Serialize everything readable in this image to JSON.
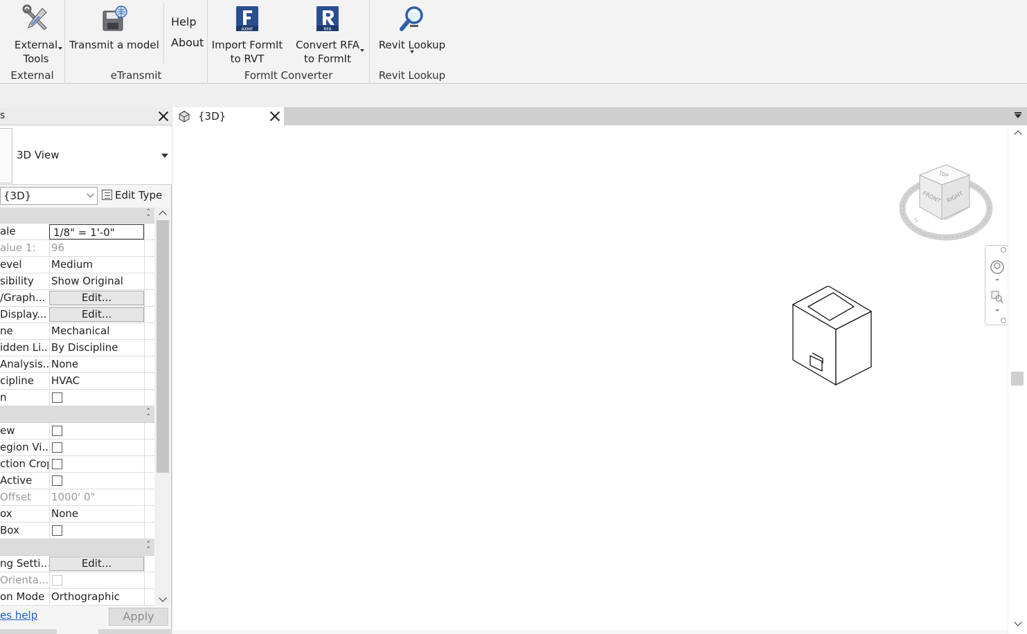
{
  "ribbon": {
    "panels": [
      {
        "title": "External",
        "buttons": [
          {
            "label_line1": "External",
            "label_line2": "Tools",
            "icon": "tools-icon"
          }
        ]
      },
      {
        "title": "eTransmit",
        "buttons": [
          {
            "label": "Transmit a model",
            "icon": "save-globe-icon"
          }
        ],
        "small_buttons": [
          "Help",
          "About"
        ]
      },
      {
        "title": "FormIt Converter",
        "buttons": [
          {
            "label_line1": "Import FormIt",
            "label_line2": "to RVT",
            "icon": "formit-f-icon",
            "badge": "AXMF"
          },
          {
            "label_line1": "Convert RFA",
            "label_line2": "to FormIt",
            "icon": "formit-r-icon",
            "badge": "RFA"
          }
        ]
      },
      {
        "title": "Revit Lookup",
        "buttons": [
          {
            "label": "Revit Lookup",
            "icon": "lookup-icon"
          }
        ]
      }
    ]
  },
  "properties": {
    "title_fragment": "s",
    "type_name": "3D View",
    "instance_selector": "{3D}",
    "edit_type_label": "Edit Type",
    "groups": [
      {
        "rows": [
          {
            "key": "ale",
            "kind": "text-active",
            "value": "1/8\" = 1'-0\""
          },
          {
            "key": "alue    1:",
            "kind": "text-gray",
            "value": "96"
          },
          {
            "key": "evel",
            "kind": "text",
            "value": "Medium"
          },
          {
            "key": "sibility",
            "kind": "text",
            "value": "Show Original"
          },
          {
            "key": "/Graph...",
            "kind": "button",
            "value": "Edit..."
          },
          {
            "key": " Display...",
            "kind": "button",
            "value": "Edit..."
          },
          {
            "key": "ne",
            "kind": "text",
            "value": "Mechanical"
          },
          {
            "key": "idden Li...",
            "kind": "text",
            "value": "By Discipline"
          },
          {
            "key": "Analysis...",
            "kind": "text",
            "value": "None"
          },
          {
            "key": "cipline",
            "kind": "text",
            "value": "HVAC"
          },
          {
            "key": "n",
            "kind": "check",
            "value": ""
          }
        ]
      },
      {
        "rows": [
          {
            "key": "ew",
            "kind": "check",
            "value": ""
          },
          {
            "key": "egion Vi...",
            "kind": "check",
            "value": ""
          },
          {
            "key": "ction Crop",
            "kind": "check",
            "value": ""
          },
          {
            "key": " Active",
            "kind": "check",
            "value": ""
          },
          {
            "key": " Offset",
            "kind": "text-gray",
            "value": "1000'  0\""
          },
          {
            "key": "ox",
            "kind": "text",
            "value": "None"
          },
          {
            "key": " Box",
            "kind": "check",
            "value": ""
          }
        ]
      },
      {
        "rows": [
          {
            "key": "ng Setti...",
            "kind": "button",
            "value": "Edit..."
          },
          {
            "key": " Orienta...",
            "kind": "check-disabled",
            "value": ""
          },
          {
            "key": "on Mode",
            "kind": "text",
            "value": "Orthographic"
          }
        ]
      }
    ],
    "help_link": "es help",
    "apply_label": "Apply"
  },
  "view": {
    "tab_label": "{3D}",
    "viewcube": {
      "top": "TOP",
      "front": "FRONT",
      "right": "RIGHT"
    }
  },
  "colors": {
    "ribbon_bg": "#f3f3f3",
    "link": "#1b5fcc",
    "formit_blue": "#2a4f8f"
  }
}
